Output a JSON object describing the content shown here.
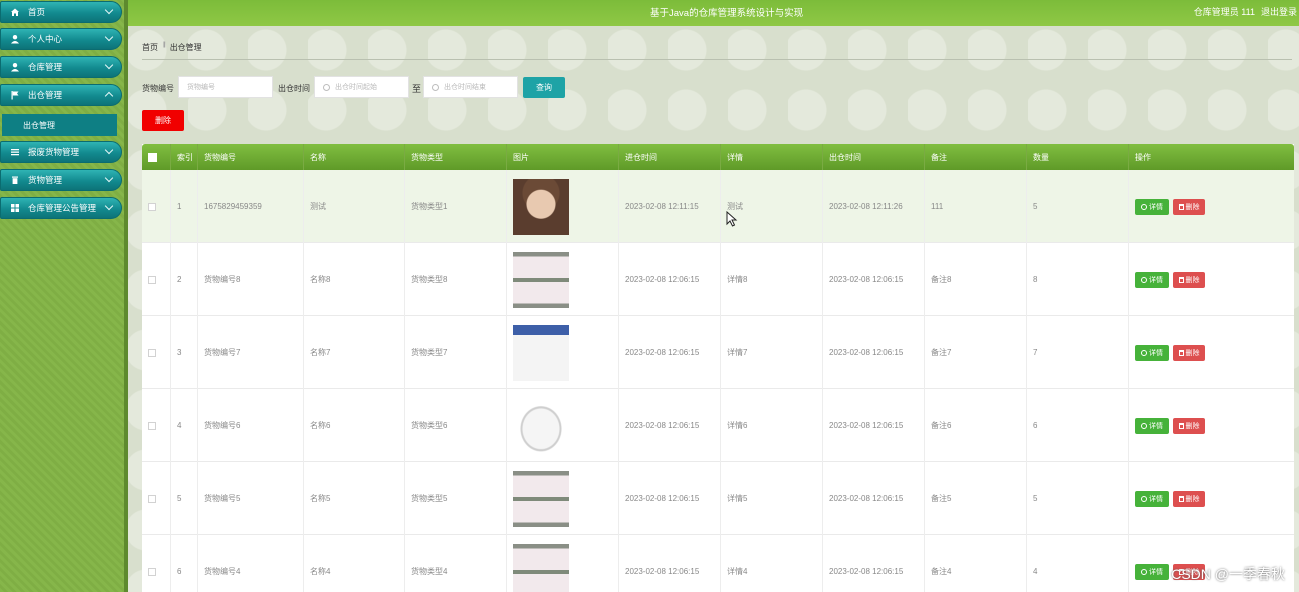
{
  "header": {
    "site_title": "基于Java的仓库管理系统设计与实现",
    "user_label": "仓库管理员 111",
    "logout_label": "退出登录"
  },
  "sidebar": {
    "items": [
      {
        "label": "首页",
        "icon": "home-icon"
      },
      {
        "label": "个人中心",
        "icon": "user-icon"
      },
      {
        "label": "仓库管理",
        "icon": "user-icon"
      },
      {
        "label": "出仓管理",
        "icon": "flag-icon"
      },
      {
        "label": "报废货物管理",
        "icon": "list-icon"
      },
      {
        "label": "货物管理",
        "icon": "trash-icon"
      },
      {
        "label": "仓库管理公告管理",
        "icon": "grid-icon"
      }
    ],
    "active_sub": "出仓管理"
  },
  "breadcrumb": {
    "home": "首页",
    "separator": "|||",
    "current": "出仓管理"
  },
  "search": {
    "goods_no_label": "货物编号",
    "goods_no_placeholder": "货物编号",
    "out_time_label": "出仓时间",
    "start_placeholder": "出仓时间起始",
    "to_label": "至",
    "end_placeholder": "出仓时间结束",
    "query_button": "查询"
  },
  "actions": {
    "delete_button": "删除"
  },
  "table": {
    "headers": [
      "",
      "索引",
      "货物编号",
      "名称",
      "货物类型",
      "图片",
      "进仓时间",
      "详情",
      "出仓时间",
      "备注",
      "数量",
      "操作"
    ],
    "detail_button": "详情",
    "delete_button": "删除",
    "rows": [
      {
        "index": "1",
        "goods_no": "1675829459359",
        "name": "测试",
        "type": "货物类型1",
        "in_time": "2023-02-08 12:11:15",
        "detail": "测试",
        "out_time": "2023-02-08 12:11:26",
        "remark": "111",
        "qty": "5"
      },
      {
        "index": "2",
        "goods_no": "货物编号8",
        "name": "名称8",
        "type": "货物类型8",
        "in_time": "2023-02-08 12:06:15",
        "detail": "详情8",
        "out_time": "2023-02-08 12:06:15",
        "remark": "备注8",
        "qty": "8"
      },
      {
        "index": "3",
        "goods_no": "货物编号7",
        "name": "名称7",
        "type": "货物类型7",
        "in_time": "2023-02-08 12:06:15",
        "detail": "详情7",
        "out_time": "2023-02-08 12:06:15",
        "remark": "备注7",
        "qty": "7"
      },
      {
        "index": "4",
        "goods_no": "货物编号6",
        "name": "名称6",
        "type": "货物类型6",
        "in_time": "2023-02-08 12:06:15",
        "detail": "详情6",
        "out_time": "2023-02-08 12:06:15",
        "remark": "备注6",
        "qty": "6"
      },
      {
        "index": "5",
        "goods_no": "货物编号5",
        "name": "名称5",
        "type": "货物类型5",
        "in_time": "2023-02-08 12:06:15",
        "detail": "详情5",
        "out_time": "2023-02-08 12:06:15",
        "remark": "备注5",
        "qty": "5"
      },
      {
        "index": "6",
        "goods_no": "货物编号4",
        "name": "名称4",
        "type": "货物类型4",
        "in_time": "2023-02-08 12:06:15",
        "detail": "详情4",
        "out_time": "2023-02-08 12:06:15",
        "remark": "备注4",
        "qty": "4"
      }
    ]
  },
  "watermark": "CSDN @一季春秋",
  "colors": {
    "header_green": "#80be40",
    "nav_teal": "#128a8f",
    "delete_red": "#f10000",
    "query_teal": "#1ea3a6"
  }
}
